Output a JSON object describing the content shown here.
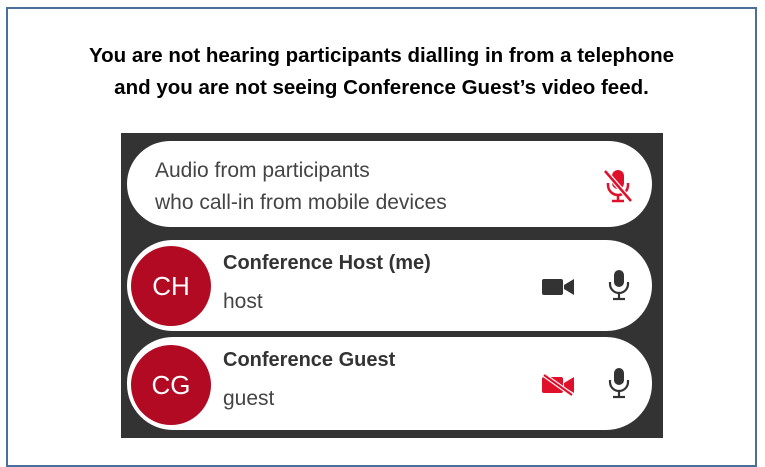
{
  "caption": {
    "line1": "You are not hearing participants dialling in from a telephone",
    "line2": "and you are not seeing Conference Guest’s video feed."
  },
  "audio_row": {
    "line1": "Audio from participants",
    "line2": "who call-in from mobile devices",
    "icon": "mic-muted-icon",
    "muted": true
  },
  "participants": [
    {
      "initials": "CH",
      "name": "Conference Host (me)",
      "role": "host",
      "video_on": true,
      "mic_on": true
    },
    {
      "initials": "CG",
      "name": "Conference Guest",
      "role": "guest",
      "video_on": false,
      "mic_on": true
    }
  ],
  "colors": {
    "avatar": "#b30a24",
    "muted_red": "#e0102b",
    "panel_bg": "#333333",
    "icon_dark": "#333333",
    "frame_border": "#4a6f9b"
  }
}
